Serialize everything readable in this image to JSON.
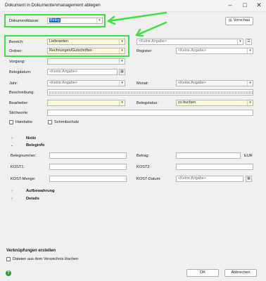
{
  "window": {
    "title": "Dokument in Dokumentenmanagement ablegen",
    "controls": {
      "minimize": "–",
      "maximize": "□",
      "close": "✕"
    }
  },
  "top": {
    "dokumentklasse_label": "Dokumentklasse:",
    "dokumentklasse_value": "Beleg",
    "vorschau_label": "Vorschau"
  },
  "form": {
    "bereich_label": "Bereich:",
    "bereich_value": "Lieferanten",
    "bereich_right_value": "<Keine Angabe>",
    "ordner_label": "Ordner:",
    "ordner_value": "Rechnungen/Gutschriften",
    "register_label": "Register:",
    "register_value": "<Keine Angabe>",
    "vorgang_label": "Vorgang:",
    "belegdatum_label": "Belegdatum:",
    "belegdatum_value": "<Keine Angabe>",
    "jahr_label": "Jahr:",
    "jahr_value": "<Keine Angabe>",
    "monat_label": "Monat:",
    "monat_value": "<Keine Angabe>",
    "beschreibung_label": "Beschreibung:",
    "bearbeiter_label": "Bearbeiter:",
    "belegstatus_label": "Belegstatus:",
    "belegstatus_value": "zu buchen",
    "stichworte_label": "Stichworte:",
    "handakte_label": "Handakte",
    "schreibschutz_label": "Schreibschutz"
  },
  "sections": {
    "notiz": "Notiz",
    "beleginfo": "Beleginfo",
    "aufbewahrung": "Aufbewahrung",
    "details": "Details"
  },
  "beleginfo": {
    "belegnummer_label": "Belegnummer:",
    "betrag_label": "Betrag:",
    "currency": "EUR",
    "kost1_label": "KOST1:",
    "kost2_label": "KOST2:",
    "kost_menge_label": "KOST-Menge:",
    "kost_datum_label": "KOST-Datum:",
    "kost_datum_value": "<Keine Angabe>"
  },
  "footer": {
    "verknuepfungen_title": "Verknüpfungen erstellen",
    "dateien_loeschen_label": "Dateien aus dem Verzeichnis löschen",
    "ok_label": "OK",
    "abbrechen_label": "Abbrechen",
    "help_glyph": "?"
  },
  "icons": {
    "dropdown": "▾",
    "chevron_right": "›",
    "chevron_down": "⌄",
    "calendar": "▦",
    "list": "☰"
  },
  "colors": {
    "annotation_green": "#3fe043",
    "selected_blue": "#0a64d6",
    "required_yellow": "#fdfbd6",
    "help_green": "#2e9d2e"
  }
}
